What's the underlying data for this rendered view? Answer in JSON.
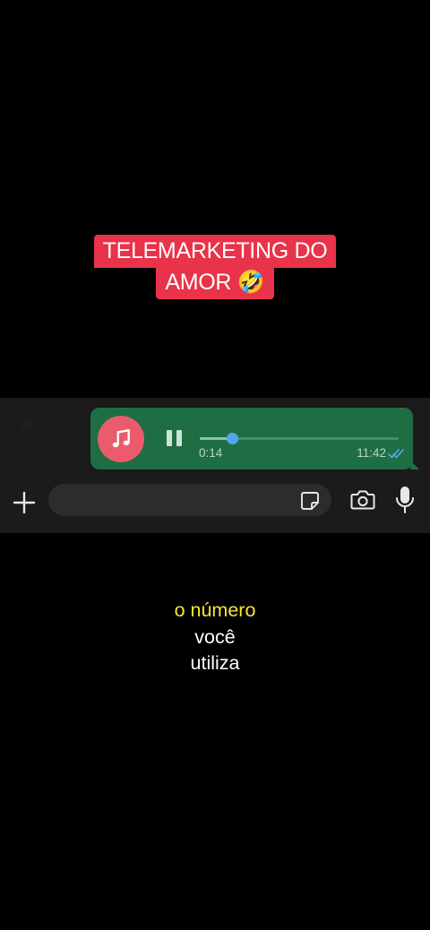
{
  "caption": {
    "line1": "TELEMARKETING DO",
    "line2": "AMOR 🤣"
  },
  "voice_message": {
    "duration": "0:14",
    "time": "11:42",
    "progress": 0.16,
    "status": "read"
  },
  "colors": {
    "caption_bg": "#e8334a",
    "bubble_bg": "#1f6e43",
    "avatar_bg": "#ea5b6d",
    "progress_dot": "#53a5f0",
    "read_ticks": "#53a5f0",
    "subtitle_highlight": "#f7e53b",
    "subtitle_normal": "#ffffff"
  },
  "input_bar": {
    "message_value": "",
    "icons": [
      "plus-icon",
      "sticker-icon",
      "camera-icon",
      "microphone-icon"
    ]
  },
  "subtitles": {
    "line1": "o número",
    "line2": "você",
    "line3": "utiliza"
  }
}
